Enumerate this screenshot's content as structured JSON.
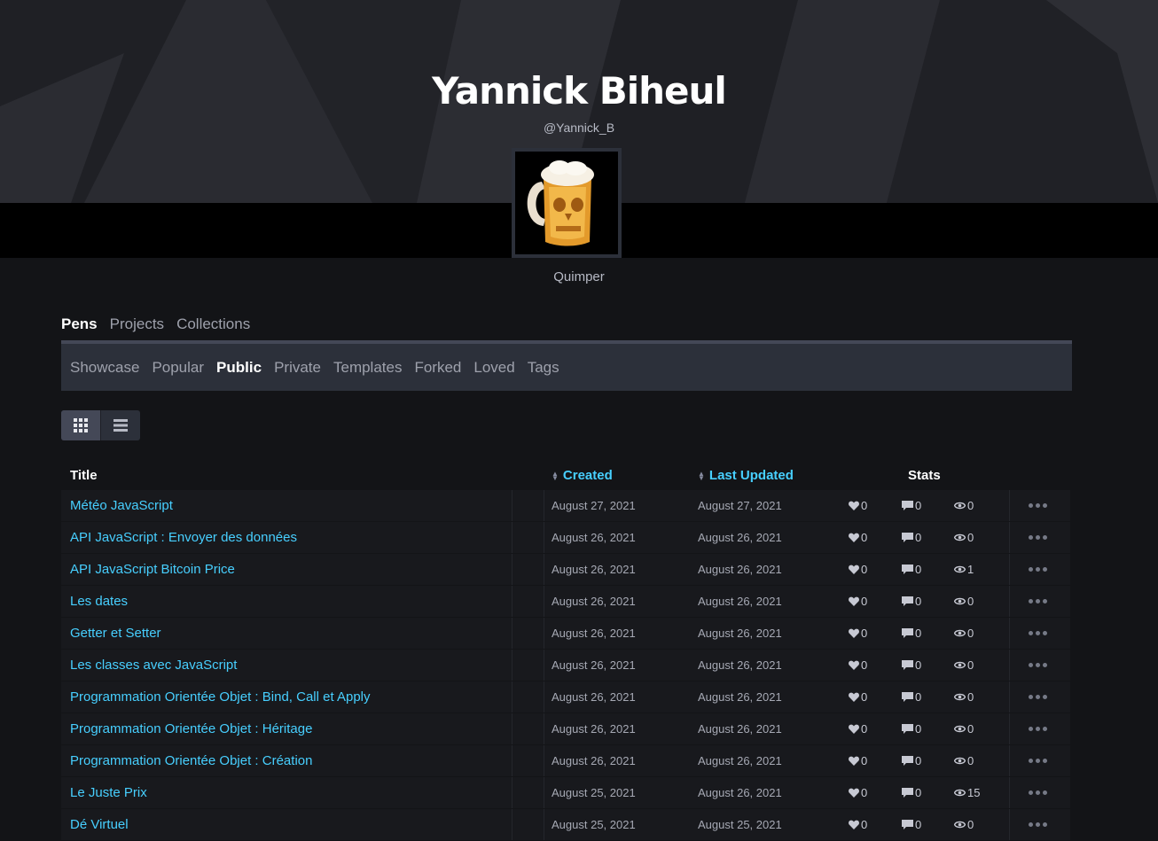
{
  "profile": {
    "name": "Yannick Biheul",
    "handle": "@Yannick_B",
    "location": "Quimper"
  },
  "main_tabs": [
    {
      "label": "Pens",
      "active": true
    },
    {
      "label": "Projects",
      "active": false
    },
    {
      "label": "Collections",
      "active": false
    }
  ],
  "sub_tabs": [
    {
      "label": "Showcase",
      "active": false
    },
    {
      "label": "Popular",
      "active": false
    },
    {
      "label": "Public",
      "active": true
    },
    {
      "label": "Private",
      "active": false
    },
    {
      "label": "Templates",
      "active": false
    },
    {
      "label": "Forked",
      "active": false
    },
    {
      "label": "Loved",
      "active": false
    },
    {
      "label": "Tags",
      "active": false
    }
  ],
  "view_toggle": {
    "grid_icon": "grid-icon",
    "list_icon": "list-icon",
    "active": "grid"
  },
  "table": {
    "headers": {
      "title": "Title",
      "created": "Created",
      "updated": "Last Updated",
      "stats": "Stats"
    },
    "rows": [
      {
        "title": "Météo JavaScript",
        "created": "August 27, 2021",
        "updated": "August 27, 2021",
        "likes": "0",
        "comments": "0",
        "views": "0"
      },
      {
        "title": "API JavaScript : Envoyer des données",
        "created": "August 26, 2021",
        "updated": "August 26, 2021",
        "likes": "0",
        "comments": "0",
        "views": "0"
      },
      {
        "title": "API JavaScript Bitcoin Price",
        "created": "August 26, 2021",
        "updated": "August 26, 2021",
        "likes": "0",
        "comments": "0",
        "views": "1"
      },
      {
        "title": "Les dates",
        "created": "August 26, 2021",
        "updated": "August 26, 2021",
        "likes": "0",
        "comments": "0",
        "views": "0"
      },
      {
        "title": "Getter et Setter",
        "created": "August 26, 2021",
        "updated": "August 26, 2021",
        "likes": "0",
        "comments": "0",
        "views": "0"
      },
      {
        "title": "Les classes avec JavaScript",
        "created": "August 26, 2021",
        "updated": "August 26, 2021",
        "likes": "0",
        "comments": "0",
        "views": "0"
      },
      {
        "title": "Programmation Orientée Objet : Bind, Call et Apply",
        "created": "August 26, 2021",
        "updated": "August 26, 2021",
        "likes": "0",
        "comments": "0",
        "views": "0"
      },
      {
        "title": "Programmation Orientée Objet : Héritage",
        "created": "August 26, 2021",
        "updated": "August 26, 2021",
        "likes": "0",
        "comments": "0",
        "views": "0"
      },
      {
        "title": "Programmation Orientée Objet : Création",
        "created": "August 26, 2021",
        "updated": "August 26, 2021",
        "likes": "0",
        "comments": "0",
        "views": "0"
      },
      {
        "title": "Le Juste Prix",
        "created": "August 25, 2021",
        "updated": "August 26, 2021",
        "likes": "0",
        "comments": "0",
        "views": "15"
      },
      {
        "title": "Dé Virtuel",
        "created": "August 25, 2021",
        "updated": "August 25, 2021",
        "likes": "0",
        "comments": "0",
        "views": "0"
      }
    ]
  },
  "colors": {
    "accent": "#47cfff",
    "background": "#131417",
    "row": "#18191d",
    "subnav": "#2c303a"
  }
}
